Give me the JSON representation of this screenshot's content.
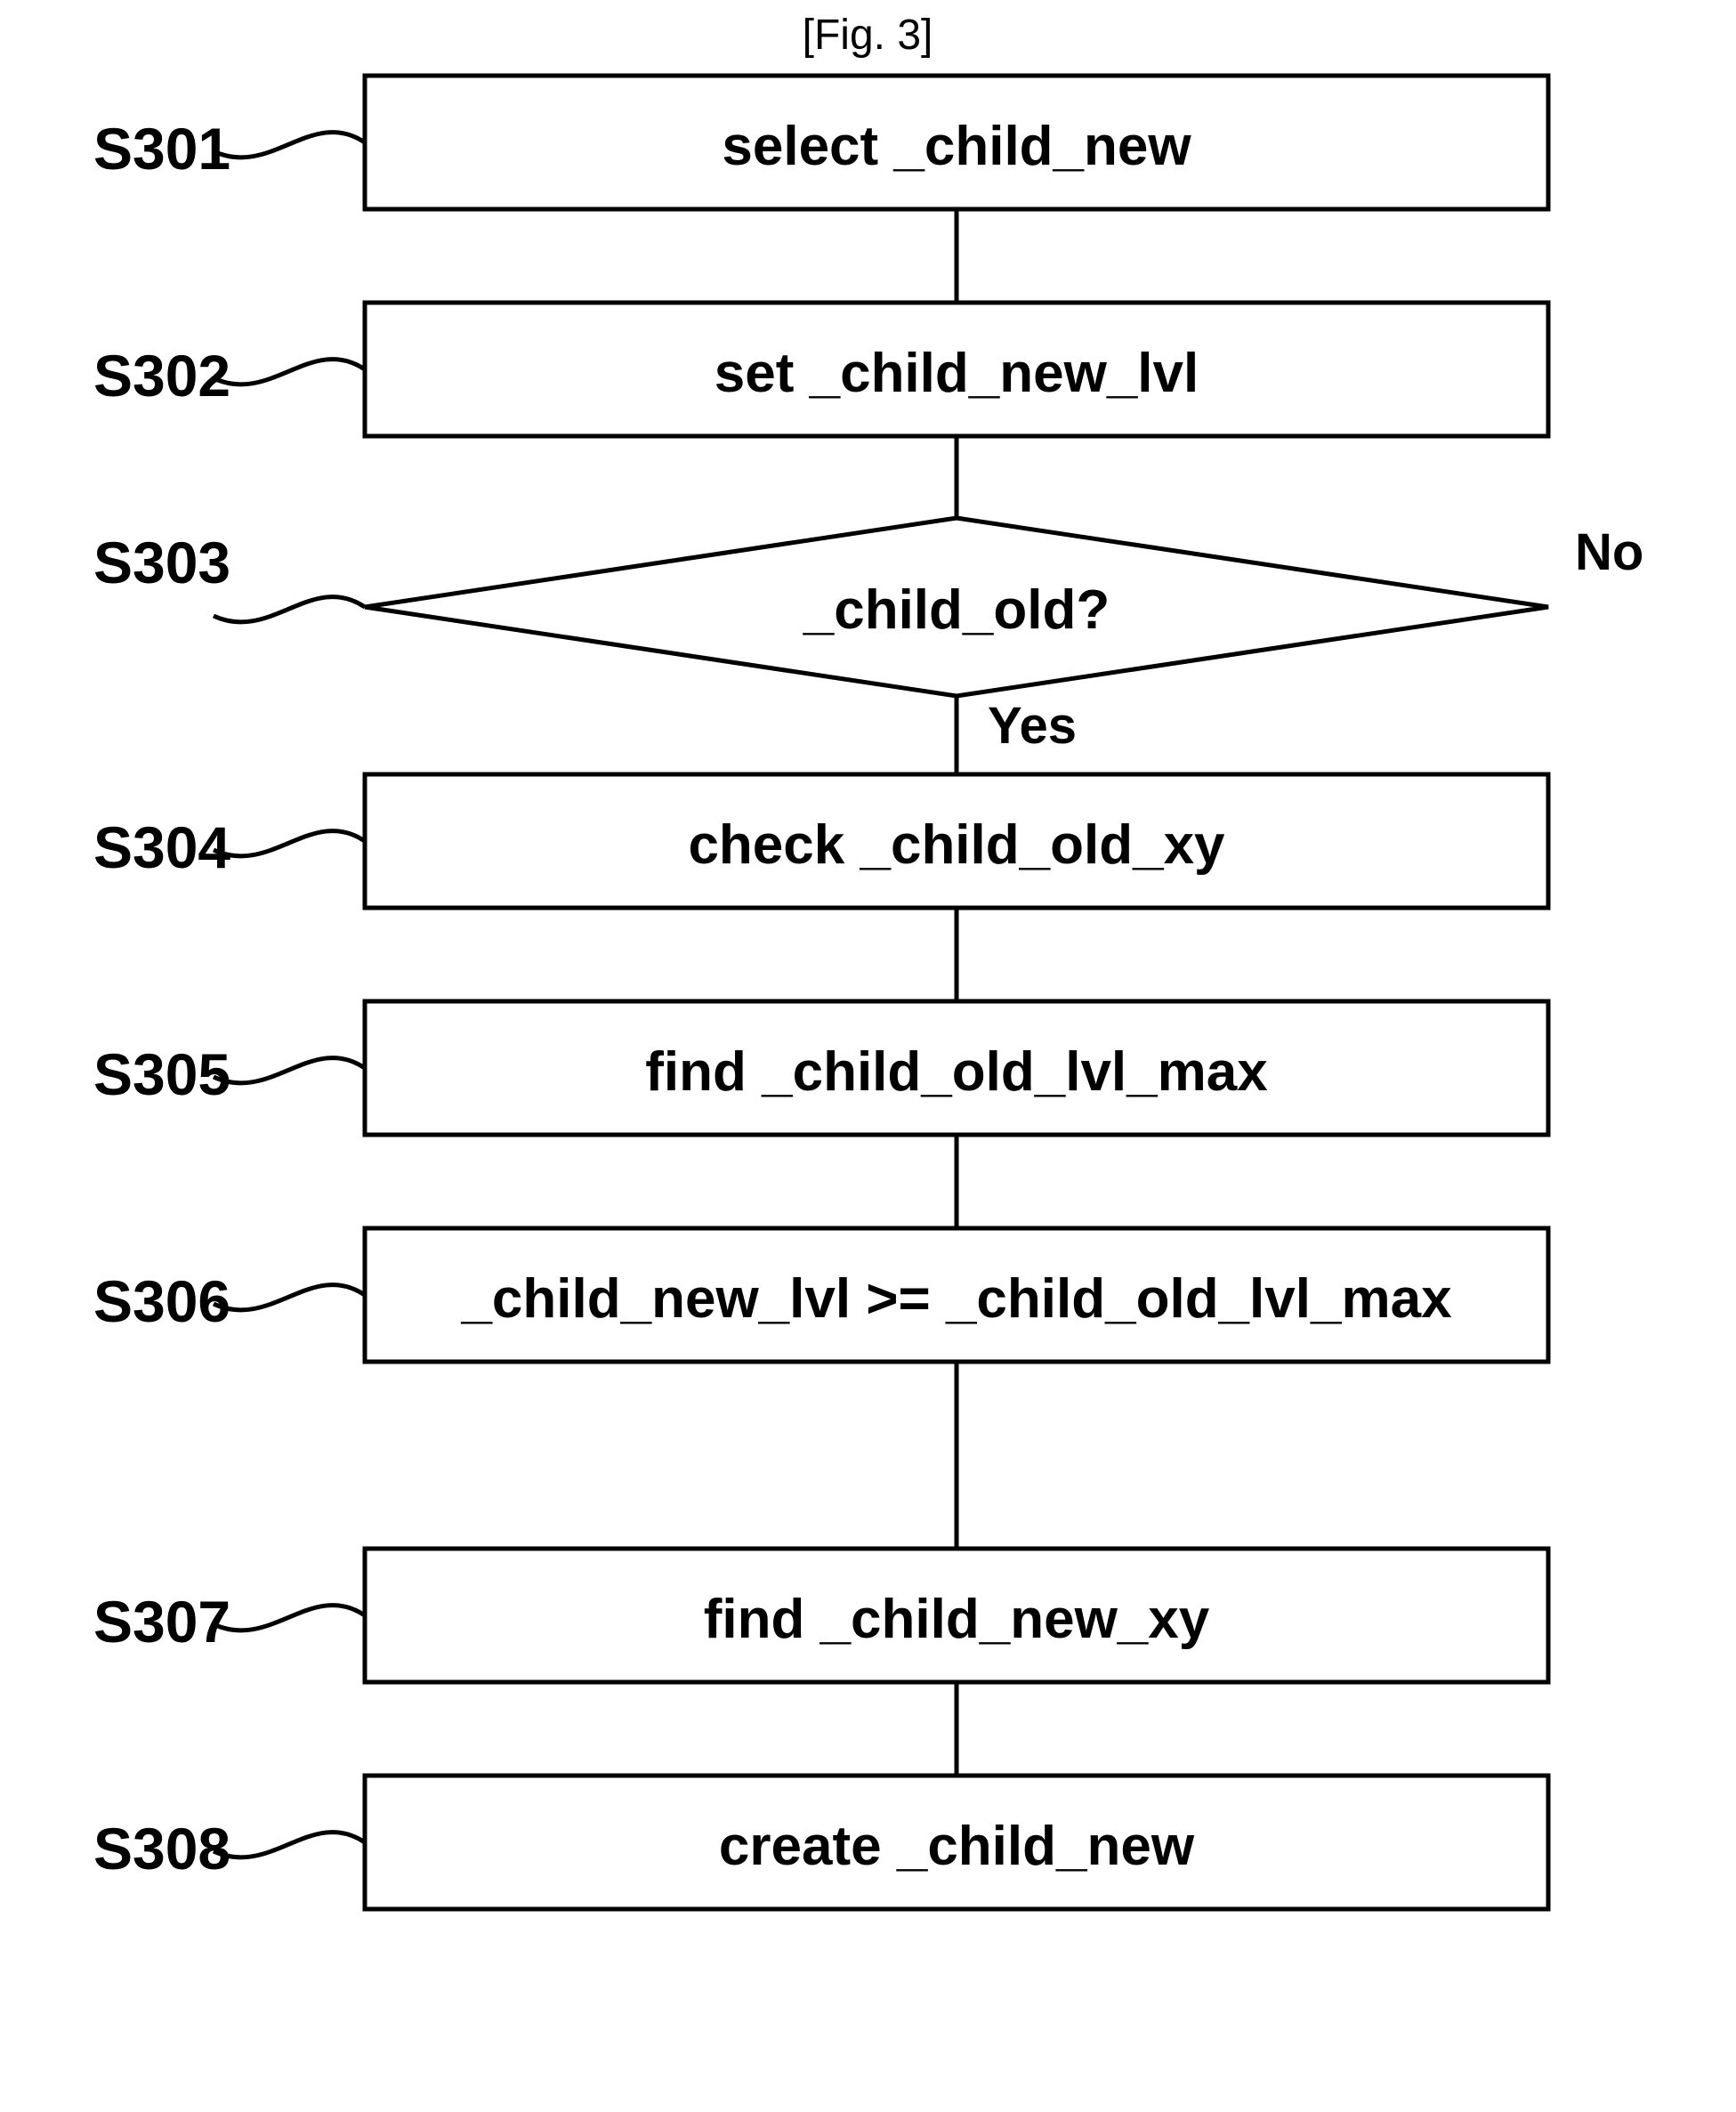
{
  "figure_label": "[Fig. 3]",
  "steps": {
    "s301": {
      "label": "S301",
      "text": "select _child_new"
    },
    "s302": {
      "label": "S302",
      "text": "set _child_new_lvl"
    },
    "s303": {
      "label": "S303",
      "text": "_child_old?",
      "yes": "Yes",
      "no": "No"
    },
    "s304": {
      "label": "S304",
      "text": "check _child_old_xy"
    },
    "s305": {
      "label": "S305",
      "text": "find _child_old_lvl_max"
    },
    "s306": {
      "label": "S306",
      "text": "_child_new_lvl >= _child_old_lvl_max"
    },
    "s307": {
      "label": "S307",
      "text": "find _child_new_xy"
    },
    "s308": {
      "label": "S308",
      "text": "create _child_new"
    }
  }
}
